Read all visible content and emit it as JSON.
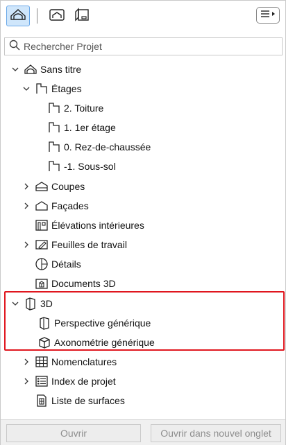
{
  "search": {
    "placeholder": "Rechercher Projet"
  },
  "tree": {
    "root": "Sans titre",
    "etages": "Étages",
    "etage_items": [
      "2. Toiture",
      "1. 1er étage",
      "0. Rez-de-chaussée",
      "-1. Sous-sol"
    ],
    "coupes": "Coupes",
    "facades": "Façades",
    "elevations": "Élévations intérieures",
    "feuilles": "Feuilles de travail",
    "details": "Détails",
    "documents3d": "Documents 3D",
    "threed": "3D",
    "perspective": "Perspective générique",
    "axonometrie": "Axonométrie générique",
    "nomenclatures": "Nomenclatures",
    "index": "Index de projet",
    "surfaces": "Liste de surfaces"
  },
  "footer": {
    "open": "Ouvrir",
    "open_new_tab": "Ouvrir dans nouvel onglet"
  },
  "colors": {
    "highlight": "#e0161e",
    "active_tab_bg": "#cfe6fb",
    "active_tab_border": "#6aa8e8"
  }
}
